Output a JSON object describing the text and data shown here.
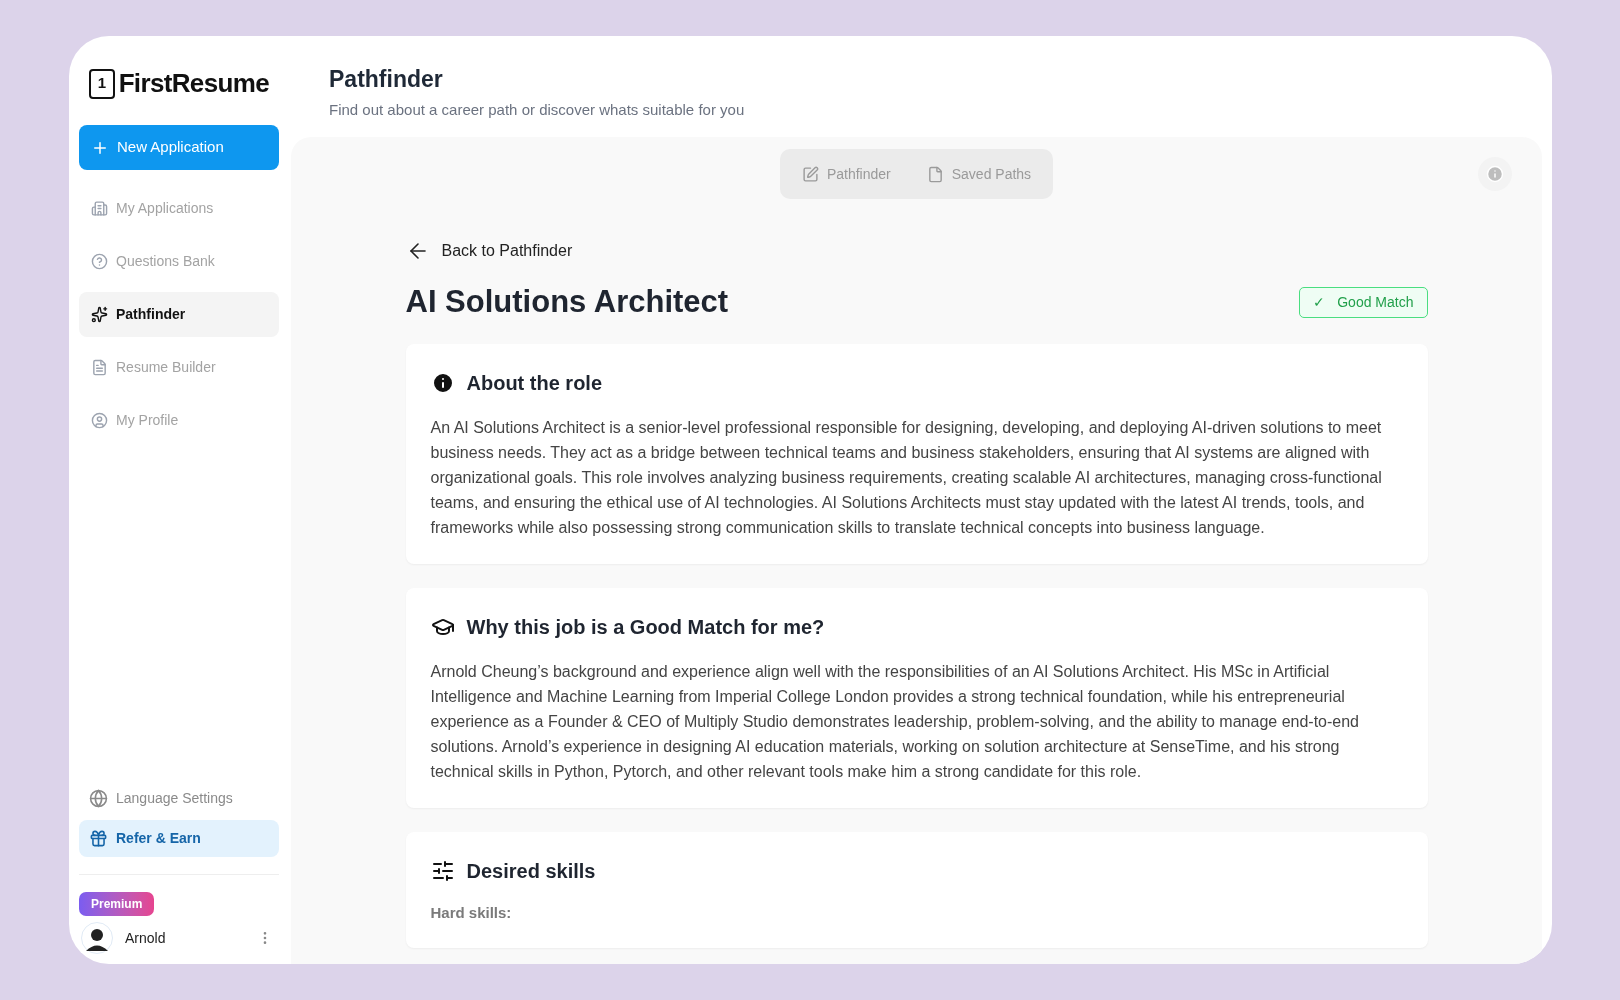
{
  "brand": {
    "badge": "1",
    "name": "FirstResume"
  },
  "sidebar": {
    "primary_action": "New Application",
    "items": [
      {
        "label": "My Applications",
        "kind": "building",
        "selected": false
      },
      {
        "label": "Questions Bank",
        "kind": "question",
        "selected": false
      },
      {
        "label": "Pathfinder",
        "kind": "sparkles",
        "selected": true
      },
      {
        "label": "Resume Builder",
        "kind": "file",
        "selected": false
      },
      {
        "label": "My Profile",
        "kind": "user",
        "selected": false
      }
    ],
    "language": "Language Settings",
    "refer": "Refer & Earn",
    "plan_badge": "Premium",
    "user": "Arnold"
  },
  "header": {
    "title": "Pathfinder",
    "subtitle": "Find out about a career path or discover whats suitable for you"
  },
  "tabs": [
    {
      "label": "Pathfinder",
      "kind": "edit",
      "selected": false
    },
    {
      "label": "Saved Paths",
      "kind": "file",
      "selected": false
    }
  ],
  "back_link": "Back to Pathfinder",
  "job": {
    "title": "AI Solutions Architect",
    "match_check": "✓",
    "match": "Good Match"
  },
  "sections": [
    {
      "kind": "info",
      "heading": "About the role",
      "text": "An AI Solutions Architect is a senior-level professional responsible for designing, developing, and deploying AI-driven solutions to meet business needs. They act as a bridge between technical teams and business stakeholders, ensuring that AI systems are aligned with organizational goals. This role involves analyzing business requirements, creating scalable AI architectures, managing cross-functional teams, and ensuring the ethical use of AI technologies. AI Solutions Architects must stay updated with the latest AI trends, tools, and frameworks while also possessing strong communication skills to translate technical concepts into business language."
    },
    {
      "kind": "cap",
      "heading": "Why this job is a Good Match for me?",
      "text": "Arnold Cheung’s background and experience align well with the responsibilities of an AI Solutions Architect. His MSc in Artificial Intelligence and Machine Learning from Imperial College London provides a strong technical foundation, while his entrepreneurial experience as a Founder & CEO of Multiply Studio demonstrates leadership, problem-solving, and the ability to manage end-to-end solutions. Arnold’s experience in designing AI education materials, working on solution architecture at SenseTime, and his strong technical skills in Python, Pytorch, and other relevant tools make him a strong candidate for this role."
    },
    {
      "kind": "sliders",
      "heading": "Desired skills",
      "subheading": "Hard skills:"
    }
  ]
}
